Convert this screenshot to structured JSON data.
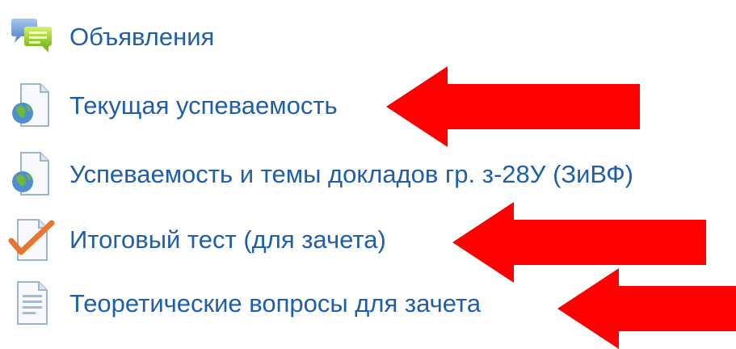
{
  "colors": {
    "link": "#1f5ea8",
    "arrow": "#ff0000"
  },
  "items": [
    {
      "label": "Объявления",
      "icon": "forum-icon"
    },
    {
      "label": "Текущая успеваемость",
      "icon": "url-resource-icon"
    },
    {
      "label": "Успеваемость и темы докладов гр. з-28У (ЗиВФ)",
      "icon": "url-resource-icon"
    },
    {
      "label": "Итоговый тест (для зачета)",
      "icon": "quiz-icon"
    },
    {
      "label": "Теоретические вопросы для зачета",
      "icon": "page-icon"
    }
  ],
  "annotations": {
    "arrows_point_to_items": [
      1,
      3,
      4
    ]
  }
}
